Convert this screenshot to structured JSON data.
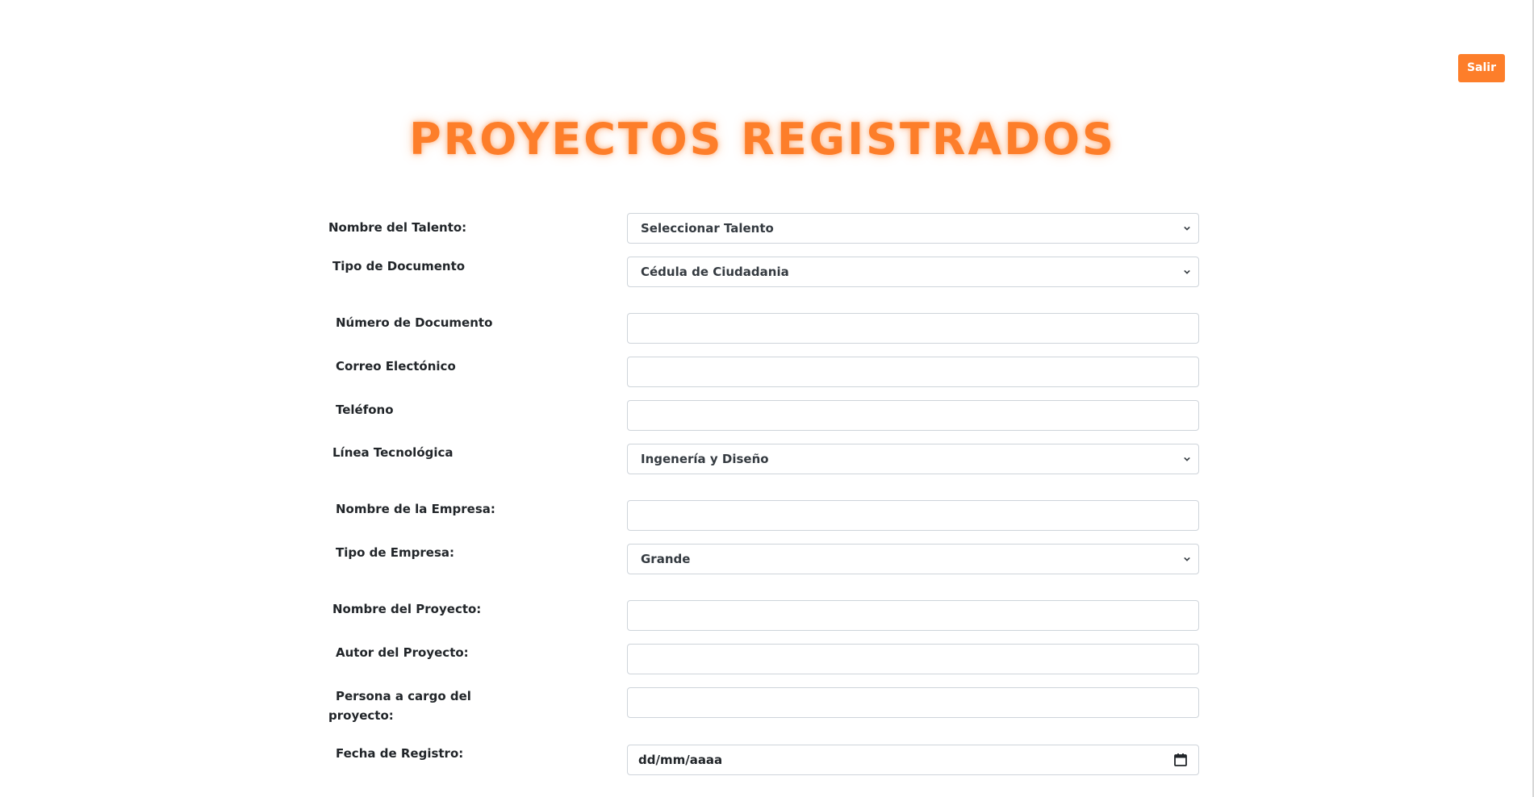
{
  "header": {
    "logout_label": "Salir",
    "title": "PROYECTOS REGISTRADOS"
  },
  "form": {
    "talento": {
      "label": "Nombre del Talento:",
      "value": "Seleccionar Talento"
    },
    "tipo_documento": {
      "label": "Tipo de Documento",
      "value": "Cédula de Ciudadania"
    },
    "numero_documento": {
      "label": "Número de Documento",
      "value": ""
    },
    "correo": {
      "label": "Correo Electónico",
      "value": ""
    },
    "telefono": {
      "label": "Teléfono",
      "value": ""
    },
    "linea": {
      "label": "Línea Tecnológica",
      "value": "Ingenería y Diseño"
    },
    "empresa": {
      "label": "Nombre de la Empresa:",
      "value": ""
    },
    "tipo_empresa": {
      "label": "Tipo de Empresa:",
      "value": "Grande"
    },
    "proyecto": {
      "label": "Nombre del Proyecto:",
      "value": ""
    },
    "autor": {
      "label": "Autor del Proyecto:",
      "value": ""
    },
    "persona_cargo": {
      "label_line1": "Persona a cargo del",
      "label_line2": "proyecto:",
      "value": ""
    },
    "fecha": {
      "label": "Fecha de Registro:",
      "placeholder": "dd/mm/aaaa"
    }
  },
  "colors": {
    "accent": "#fd7e2a",
    "border": "#ced4da",
    "text": "#212529"
  },
  "icons": {
    "select_arrow": "chevron-down-icon",
    "date_picker": "calendar-icon"
  }
}
